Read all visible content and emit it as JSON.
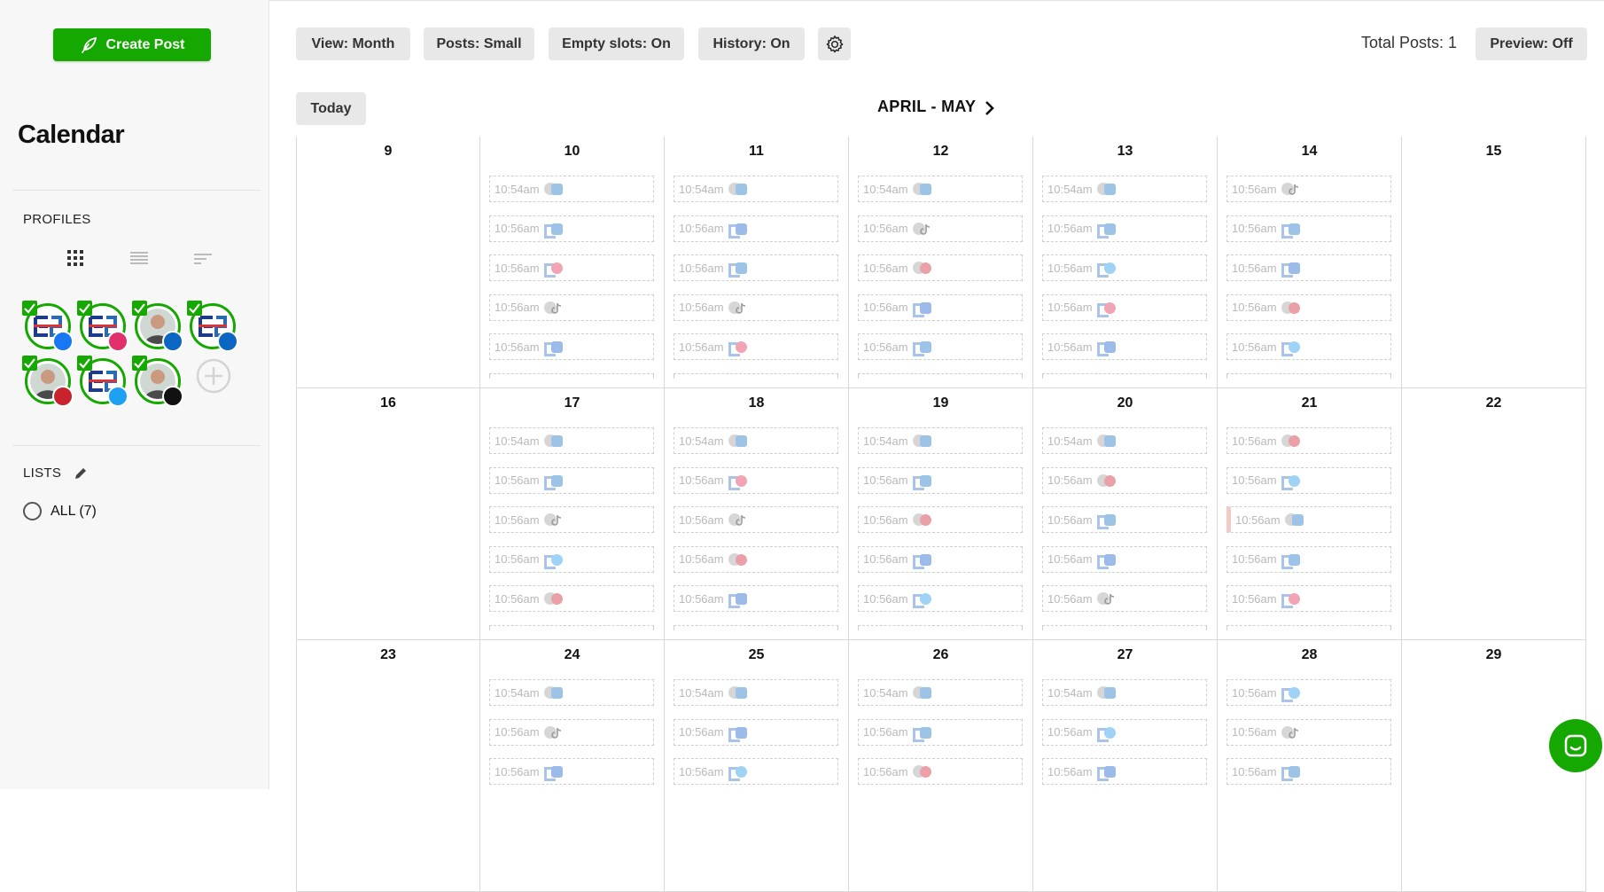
{
  "sidebar": {
    "create_post_label": "Create Post",
    "title": "Calendar",
    "profiles_label": "PROFILES",
    "lists_label": "LISTS",
    "lists_all_label": "ALL (7)",
    "profiles": [
      {
        "kind": "brand",
        "network": "facebook"
      },
      {
        "kind": "brand",
        "network": "instagram"
      },
      {
        "kind": "person",
        "network": "linkedin"
      },
      {
        "kind": "brand",
        "network": "linkedin"
      },
      {
        "kind": "person",
        "network": "pinterest"
      },
      {
        "kind": "brand",
        "network": "twitter"
      },
      {
        "kind": "person",
        "network": "tiktok"
      }
    ]
  },
  "toolbar": {
    "view": "View: Month",
    "posts": "Posts: Small",
    "empty_slots": "Empty slots: On",
    "history": "History: On",
    "total_posts": "Total Posts: 1",
    "preview": "Preview: Off",
    "today": "Today",
    "month_label": "APRIL - MAY"
  },
  "network_colors": {
    "linkedin": "#9dc3e6",
    "facebook": "#9dbbe8",
    "instagram": "#f1a4b4",
    "twitter": "#9fd3f5",
    "pinterest": "#eaa0a7",
    "tiktok": "#b8b8b8"
  },
  "weeks": [
    {
      "days": [
        {
          "day": "9",
          "slots": []
        },
        {
          "day": "10",
          "slots": [
            {
              "time": "10:54am",
              "icon": "person",
              "net": "linkedin"
            },
            {
              "time": "10:56am",
              "icon": "brand",
              "net": "linkedin"
            },
            {
              "time": "10:56am",
              "icon": "brand",
              "net": "instagram"
            },
            {
              "time": "10:56am",
              "icon": "person",
              "net": "tiktok"
            },
            {
              "time": "10:56am",
              "icon": "brand",
              "net": "facebook"
            }
          ]
        },
        {
          "day": "11",
          "slots": [
            {
              "time": "10:54am",
              "icon": "person",
              "net": "linkedin"
            },
            {
              "time": "10:56am",
              "icon": "brand",
              "net": "facebook"
            },
            {
              "time": "10:56am",
              "icon": "brand",
              "net": "linkedin"
            },
            {
              "time": "10:56am",
              "icon": "person",
              "net": "tiktok"
            },
            {
              "time": "10:56am",
              "icon": "brand",
              "net": "instagram"
            }
          ]
        },
        {
          "day": "12",
          "slots": [
            {
              "time": "10:54am",
              "icon": "person",
              "net": "linkedin"
            },
            {
              "time": "10:56am",
              "icon": "person",
              "net": "tiktok"
            },
            {
              "time": "10:56am",
              "icon": "person",
              "net": "pinterest"
            },
            {
              "time": "10:56am",
              "icon": "brand",
              "net": "facebook"
            },
            {
              "time": "10:56am",
              "icon": "brand",
              "net": "linkedin"
            }
          ]
        },
        {
          "day": "13",
          "slots": [
            {
              "time": "10:54am",
              "icon": "person",
              "net": "linkedin"
            },
            {
              "time": "10:56am",
              "icon": "brand",
              "net": "linkedin"
            },
            {
              "time": "10:56am",
              "icon": "brand",
              "net": "twitter"
            },
            {
              "time": "10:56am",
              "icon": "brand",
              "net": "instagram"
            },
            {
              "time": "10:56am",
              "icon": "brand",
              "net": "facebook"
            }
          ]
        },
        {
          "day": "14",
          "slots": [
            {
              "time": "10:56am",
              "icon": "person",
              "net": "tiktok"
            },
            {
              "time": "10:56am",
              "icon": "brand",
              "net": "linkedin"
            },
            {
              "time": "10:56am",
              "icon": "brand",
              "net": "facebook"
            },
            {
              "time": "10:56am",
              "icon": "person",
              "net": "pinterest"
            },
            {
              "time": "10:56am",
              "icon": "brand",
              "net": "twitter"
            }
          ]
        },
        {
          "day": "15",
          "slots": []
        }
      ]
    },
    {
      "days": [
        {
          "day": "16",
          "slots": []
        },
        {
          "day": "17",
          "slots": [
            {
              "time": "10:54am",
              "icon": "person",
              "net": "linkedin"
            },
            {
              "time": "10:56am",
              "icon": "brand",
              "net": "linkedin"
            },
            {
              "time": "10:56am",
              "icon": "person",
              "net": "tiktok"
            },
            {
              "time": "10:56am",
              "icon": "brand",
              "net": "twitter"
            },
            {
              "time": "10:56am",
              "icon": "person",
              "net": "pinterest"
            }
          ]
        },
        {
          "day": "18",
          "slots": [
            {
              "time": "10:54am",
              "icon": "person",
              "net": "linkedin"
            },
            {
              "time": "10:56am",
              "icon": "brand",
              "net": "instagram"
            },
            {
              "time": "10:56am",
              "icon": "person",
              "net": "tiktok"
            },
            {
              "time": "10:56am",
              "icon": "person",
              "net": "pinterest"
            },
            {
              "time": "10:56am",
              "icon": "brand",
              "net": "facebook"
            }
          ]
        },
        {
          "day": "19",
          "slots": [
            {
              "time": "10:54am",
              "icon": "person",
              "net": "linkedin"
            },
            {
              "time": "10:56am",
              "icon": "brand",
              "net": "linkedin"
            },
            {
              "time": "10:56am",
              "icon": "person",
              "net": "pinterest"
            },
            {
              "time": "10:56am",
              "icon": "brand",
              "net": "facebook"
            },
            {
              "time": "10:56am",
              "icon": "brand",
              "net": "twitter"
            }
          ]
        },
        {
          "day": "20",
          "slots": [
            {
              "time": "10:54am",
              "icon": "person",
              "net": "linkedin"
            },
            {
              "time": "10:56am",
              "icon": "person",
              "net": "pinterest"
            },
            {
              "time": "10:56am",
              "icon": "brand",
              "net": "linkedin"
            },
            {
              "time": "10:56am",
              "icon": "brand",
              "net": "facebook"
            },
            {
              "time": "10:56am",
              "icon": "person",
              "net": "tiktok"
            }
          ]
        },
        {
          "day": "21",
          "slots": [
            {
              "time": "10:56am",
              "icon": "person",
              "net": "pinterest"
            },
            {
              "time": "10:56am",
              "icon": "brand",
              "net": "twitter"
            },
            {
              "time": "10:56am",
              "icon": "person",
              "net": "linkedin",
              "marked": true
            },
            {
              "time": "10:56am",
              "icon": "brand",
              "net": "linkedin"
            },
            {
              "time": "10:56am",
              "icon": "brand",
              "net": "instagram"
            }
          ]
        },
        {
          "day": "22",
          "slots": []
        }
      ]
    },
    {
      "days": [
        {
          "day": "23",
          "slots": []
        },
        {
          "day": "24",
          "slots": [
            {
              "time": "10:54am",
              "icon": "person",
              "net": "linkedin"
            },
            {
              "time": "10:56am",
              "icon": "person",
              "net": "tiktok"
            },
            {
              "time": "10:56am",
              "icon": "brand",
              "net": "facebook"
            }
          ]
        },
        {
          "day": "25",
          "slots": [
            {
              "time": "10:54am",
              "icon": "person",
              "net": "linkedin"
            },
            {
              "time": "10:56am",
              "icon": "brand",
              "net": "facebook"
            },
            {
              "time": "10:56am",
              "icon": "brand",
              "net": "twitter"
            }
          ]
        },
        {
          "day": "26",
          "slots": [
            {
              "time": "10:54am",
              "icon": "person",
              "net": "linkedin"
            },
            {
              "time": "10:56am",
              "icon": "brand",
              "net": "linkedin"
            },
            {
              "time": "10:56am",
              "icon": "person",
              "net": "pinterest"
            }
          ]
        },
        {
          "day": "27",
          "slots": [
            {
              "time": "10:54am",
              "icon": "person",
              "net": "linkedin"
            },
            {
              "time": "10:56am",
              "icon": "brand",
              "net": "twitter"
            },
            {
              "time": "10:56am",
              "icon": "brand",
              "net": "facebook"
            }
          ]
        },
        {
          "day": "28",
          "slots": [
            {
              "time": "10:56am",
              "icon": "brand",
              "net": "twitter"
            },
            {
              "time": "10:56am",
              "icon": "person",
              "net": "tiktok"
            },
            {
              "time": "10:56am",
              "icon": "brand",
              "net": "linkedin"
            }
          ]
        },
        {
          "day": "29",
          "slots": []
        }
      ]
    }
  ]
}
